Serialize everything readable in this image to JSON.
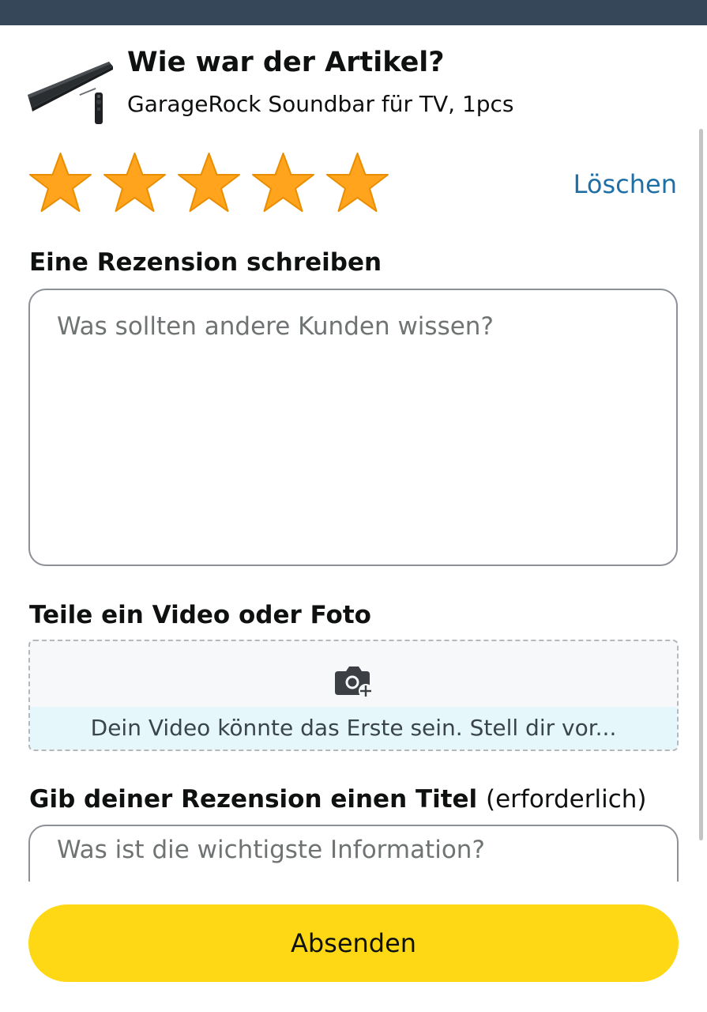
{
  "product": {
    "heading": "Wie war der Artikel?",
    "name": "GarageRock Soundbar für TV, 1pcs",
    "image": "soundbar-with-remote-image"
  },
  "rating": {
    "value": 5,
    "max": 5,
    "star_color": "#ffa41c",
    "star_outline_color": "#e88e00",
    "clear_label": "Löschen"
  },
  "review": {
    "label": "Eine Rezension schreiben",
    "value": "",
    "placeholder": "Was sollten andere Kunden wissen?"
  },
  "media": {
    "label": "Teile ein Video oder Foto",
    "icon": "camera-add-icon",
    "hint": "Dein Video könnte das Erste sein. Stell dir vor..."
  },
  "title_field": {
    "label": "Gib deiner Rezension einen Titel",
    "required_note": "(erforderlich)",
    "value": "",
    "placeholder": "Was ist die wichtigste Information?"
  },
  "submit": {
    "label": "Absenden",
    "color": "#fed814"
  },
  "colors": {
    "top_bar": "#37475a",
    "link": "#1f6fa6"
  }
}
